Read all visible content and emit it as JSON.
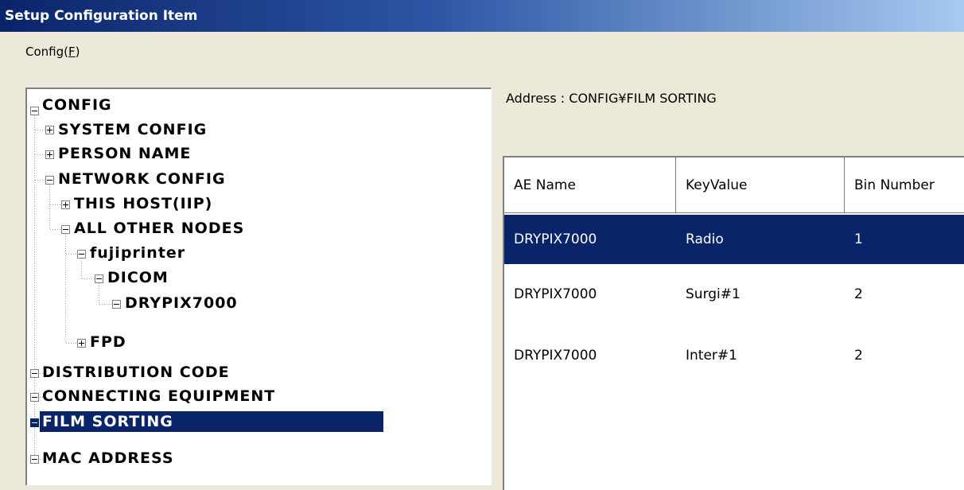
{
  "window": {
    "title": "Setup Configuration Item"
  },
  "menu": {
    "config_label": "Config(",
    "config_accel": "F",
    "config_close": ")"
  },
  "tree": {
    "nodes": [
      {
        "label": "CONFIG",
        "expander": "minus"
      },
      {
        "label": "SYSTEM CONFIG",
        "expander": "plus"
      },
      {
        "label": "PERSON NAME",
        "expander": "plus"
      },
      {
        "label": "NETWORK CONFIG",
        "expander": "minus"
      },
      {
        "label": "THIS HOST(IIP)",
        "expander": "plus"
      },
      {
        "label": "ALL OTHER NODES",
        "expander": "minus"
      },
      {
        "label": "fujiprinter",
        "expander": "minus"
      },
      {
        "label": "DICOM",
        "expander": "minus"
      },
      {
        "label": "DRYPIX7000",
        "expander": "minus"
      },
      {
        "label": "FPD",
        "expander": "plus"
      },
      {
        "label": "DISTRIBUTION CODE",
        "expander": "minus"
      },
      {
        "label": "CONNECTING EQUIPMENT",
        "expander": "minus"
      },
      {
        "label": "FILM SORTING",
        "expander": "minus",
        "selected": true
      },
      {
        "label": "MAC ADDRESS",
        "expander": "minus"
      }
    ]
  },
  "address": {
    "text": "Address :  CONFIG¥FILM SORTING"
  },
  "grid": {
    "columns": [
      "AE Name",
      "KeyValue",
      "Bin Number"
    ],
    "rows": [
      {
        "ae_name": "DRYPIX7000",
        "key_value": "Radio",
        "bin_number": "1",
        "selected": true
      },
      {
        "ae_name": "DRYPIX7000",
        "key_value": "Surgi#1",
        "bin_number": "2"
      },
      {
        "ae_name": "DRYPIX7000",
        "key_value": "Inter#1",
        "bin_number": "2"
      }
    ]
  },
  "colors": {
    "selection": "#0a246a",
    "window_bg": "#ece9d8",
    "titlebar_start": "#0a246a",
    "titlebar_end": "#a6caf0"
  }
}
